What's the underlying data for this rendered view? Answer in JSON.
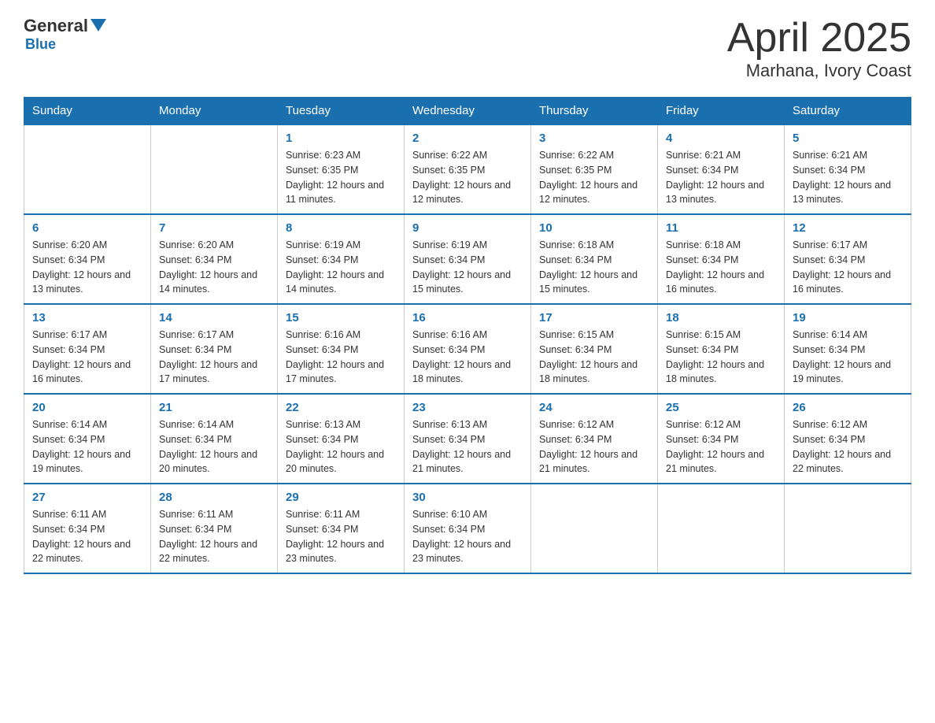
{
  "logo": {
    "general": "General",
    "blue": "Blue",
    "subtitle": "Blue"
  },
  "title": "April 2025",
  "subtitle": "Marhana, Ivory Coast",
  "days_of_week": [
    "Sunday",
    "Monday",
    "Tuesday",
    "Wednesday",
    "Thursday",
    "Friday",
    "Saturday"
  ],
  "weeks": [
    [
      {
        "day": "",
        "sunrise": "",
        "sunset": "",
        "daylight": ""
      },
      {
        "day": "",
        "sunrise": "",
        "sunset": "",
        "daylight": ""
      },
      {
        "day": "1",
        "sunrise": "Sunrise: 6:23 AM",
        "sunset": "Sunset: 6:35 PM",
        "daylight": "Daylight: 12 hours and 11 minutes."
      },
      {
        "day": "2",
        "sunrise": "Sunrise: 6:22 AM",
        "sunset": "Sunset: 6:35 PM",
        "daylight": "Daylight: 12 hours and 12 minutes."
      },
      {
        "day": "3",
        "sunrise": "Sunrise: 6:22 AM",
        "sunset": "Sunset: 6:35 PM",
        "daylight": "Daylight: 12 hours and 12 minutes."
      },
      {
        "day": "4",
        "sunrise": "Sunrise: 6:21 AM",
        "sunset": "Sunset: 6:34 PM",
        "daylight": "Daylight: 12 hours and 13 minutes."
      },
      {
        "day": "5",
        "sunrise": "Sunrise: 6:21 AM",
        "sunset": "Sunset: 6:34 PM",
        "daylight": "Daylight: 12 hours and 13 minutes."
      }
    ],
    [
      {
        "day": "6",
        "sunrise": "Sunrise: 6:20 AM",
        "sunset": "Sunset: 6:34 PM",
        "daylight": "Daylight: 12 hours and 13 minutes."
      },
      {
        "day": "7",
        "sunrise": "Sunrise: 6:20 AM",
        "sunset": "Sunset: 6:34 PM",
        "daylight": "Daylight: 12 hours and 14 minutes."
      },
      {
        "day": "8",
        "sunrise": "Sunrise: 6:19 AM",
        "sunset": "Sunset: 6:34 PM",
        "daylight": "Daylight: 12 hours and 14 minutes."
      },
      {
        "day": "9",
        "sunrise": "Sunrise: 6:19 AM",
        "sunset": "Sunset: 6:34 PM",
        "daylight": "Daylight: 12 hours and 15 minutes."
      },
      {
        "day": "10",
        "sunrise": "Sunrise: 6:18 AM",
        "sunset": "Sunset: 6:34 PM",
        "daylight": "Daylight: 12 hours and 15 minutes."
      },
      {
        "day": "11",
        "sunrise": "Sunrise: 6:18 AM",
        "sunset": "Sunset: 6:34 PM",
        "daylight": "Daylight: 12 hours and 16 minutes."
      },
      {
        "day": "12",
        "sunrise": "Sunrise: 6:17 AM",
        "sunset": "Sunset: 6:34 PM",
        "daylight": "Daylight: 12 hours and 16 minutes."
      }
    ],
    [
      {
        "day": "13",
        "sunrise": "Sunrise: 6:17 AM",
        "sunset": "Sunset: 6:34 PM",
        "daylight": "Daylight: 12 hours and 16 minutes."
      },
      {
        "day": "14",
        "sunrise": "Sunrise: 6:17 AM",
        "sunset": "Sunset: 6:34 PM",
        "daylight": "Daylight: 12 hours and 17 minutes."
      },
      {
        "day": "15",
        "sunrise": "Sunrise: 6:16 AM",
        "sunset": "Sunset: 6:34 PM",
        "daylight": "Daylight: 12 hours and 17 minutes."
      },
      {
        "day": "16",
        "sunrise": "Sunrise: 6:16 AM",
        "sunset": "Sunset: 6:34 PM",
        "daylight": "Daylight: 12 hours and 18 minutes."
      },
      {
        "day": "17",
        "sunrise": "Sunrise: 6:15 AM",
        "sunset": "Sunset: 6:34 PM",
        "daylight": "Daylight: 12 hours and 18 minutes."
      },
      {
        "day": "18",
        "sunrise": "Sunrise: 6:15 AM",
        "sunset": "Sunset: 6:34 PM",
        "daylight": "Daylight: 12 hours and 18 minutes."
      },
      {
        "day": "19",
        "sunrise": "Sunrise: 6:14 AM",
        "sunset": "Sunset: 6:34 PM",
        "daylight": "Daylight: 12 hours and 19 minutes."
      }
    ],
    [
      {
        "day": "20",
        "sunrise": "Sunrise: 6:14 AM",
        "sunset": "Sunset: 6:34 PM",
        "daylight": "Daylight: 12 hours and 19 minutes."
      },
      {
        "day": "21",
        "sunrise": "Sunrise: 6:14 AM",
        "sunset": "Sunset: 6:34 PM",
        "daylight": "Daylight: 12 hours and 20 minutes."
      },
      {
        "day": "22",
        "sunrise": "Sunrise: 6:13 AM",
        "sunset": "Sunset: 6:34 PM",
        "daylight": "Daylight: 12 hours and 20 minutes."
      },
      {
        "day": "23",
        "sunrise": "Sunrise: 6:13 AM",
        "sunset": "Sunset: 6:34 PM",
        "daylight": "Daylight: 12 hours and 21 minutes."
      },
      {
        "day": "24",
        "sunrise": "Sunrise: 6:12 AM",
        "sunset": "Sunset: 6:34 PM",
        "daylight": "Daylight: 12 hours and 21 minutes."
      },
      {
        "day": "25",
        "sunrise": "Sunrise: 6:12 AM",
        "sunset": "Sunset: 6:34 PM",
        "daylight": "Daylight: 12 hours and 21 minutes."
      },
      {
        "day": "26",
        "sunrise": "Sunrise: 6:12 AM",
        "sunset": "Sunset: 6:34 PM",
        "daylight": "Daylight: 12 hours and 22 minutes."
      }
    ],
    [
      {
        "day": "27",
        "sunrise": "Sunrise: 6:11 AM",
        "sunset": "Sunset: 6:34 PM",
        "daylight": "Daylight: 12 hours and 22 minutes."
      },
      {
        "day": "28",
        "sunrise": "Sunrise: 6:11 AM",
        "sunset": "Sunset: 6:34 PM",
        "daylight": "Daylight: 12 hours and 22 minutes."
      },
      {
        "day": "29",
        "sunrise": "Sunrise: 6:11 AM",
        "sunset": "Sunset: 6:34 PM",
        "daylight": "Daylight: 12 hours and 23 minutes."
      },
      {
        "day": "30",
        "sunrise": "Sunrise: 6:10 AM",
        "sunset": "Sunset: 6:34 PM",
        "daylight": "Daylight: 12 hours and 23 minutes."
      },
      {
        "day": "",
        "sunrise": "",
        "sunset": "",
        "daylight": ""
      },
      {
        "day": "",
        "sunrise": "",
        "sunset": "",
        "daylight": ""
      },
      {
        "day": "",
        "sunrise": "",
        "sunset": "",
        "daylight": ""
      }
    ]
  ]
}
